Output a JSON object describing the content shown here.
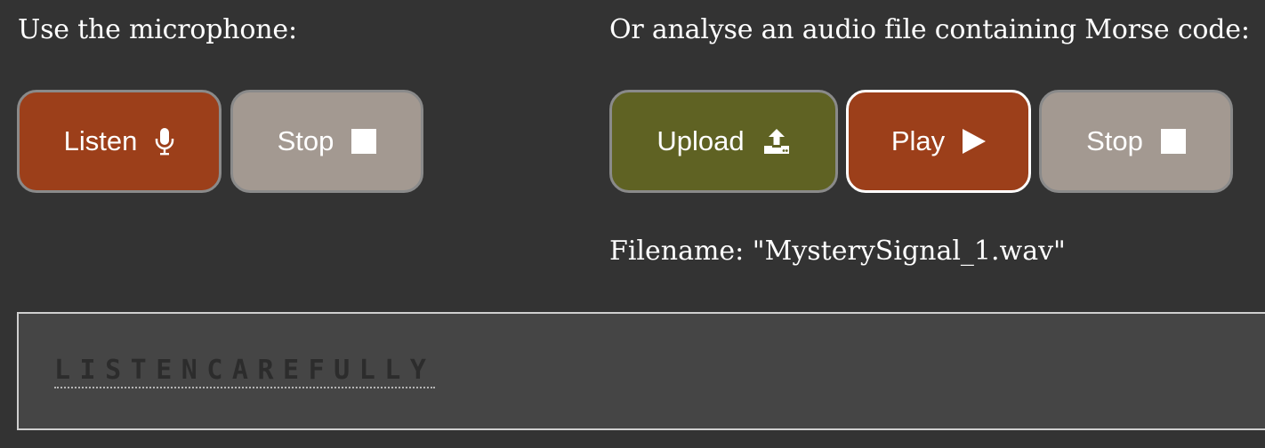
{
  "microphone": {
    "label": "Use the microphone:",
    "listen_button": {
      "label": "Listen",
      "icon": "microphone-icon",
      "color": "#9c3f1a"
    },
    "stop_button": {
      "label": "Stop",
      "icon": "stop-icon",
      "color": "#a39991"
    }
  },
  "audio_file": {
    "label": "Or analyse an audio file containing Morse code:",
    "upload_button": {
      "label": "Upload",
      "icon": "upload-icon",
      "color": "#5f6223"
    },
    "play_button": {
      "label": "Play",
      "icon": "play-icon",
      "color": "#9c3f1a"
    },
    "stop_button": {
      "label": "Stop",
      "icon": "stop-icon",
      "color": "#a39991"
    },
    "filename": "Filename: \"MysterySignal_1.wav\""
  },
  "output": {
    "decoded_text": "LISTENCAREFULLY"
  }
}
